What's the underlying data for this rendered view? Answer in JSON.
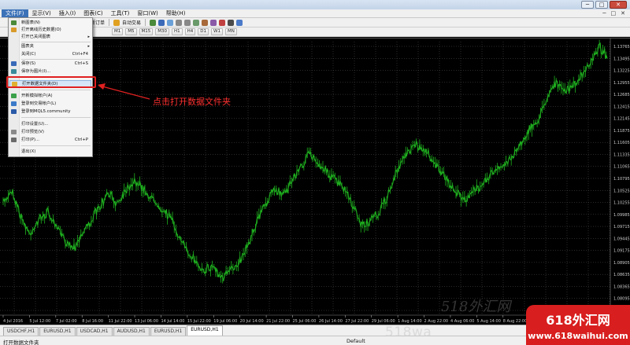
{
  "window": {
    "min_glyph": "─",
    "max_glyph": "□",
    "close_glyph": "✕"
  },
  "menubar": {
    "items": [
      "文件(F)",
      "显示(V)",
      "插入(I)",
      "图表(C)",
      "工具(T)",
      "窗口(W)",
      "帮助(H)"
    ],
    "right_items": [
      "─",
      "□",
      "✕"
    ]
  },
  "toolbar1": {
    "new_order": "新订单",
    "autotrade": "自动交易"
  },
  "toolbar2": {
    "timeframes": [
      "M1",
      "M5",
      "M15",
      "M30",
      "H1",
      "H4",
      "D1",
      "W1",
      "MN"
    ]
  },
  "file_menu": {
    "items": [
      {
        "label": "新图表(N)",
        "shortcut": "",
        "icon": "new-chart-icon",
        "color": "#4a8a3a"
      },
      {
        "label": "打开离线历史数据(O)",
        "shortcut": "",
        "icon": "offline-icon",
        "color": "#d89a2a"
      },
      {
        "label": "打开已关闭图表",
        "shortcut": "",
        "icon": "",
        "color": "",
        "submenu": true
      },
      {
        "label": "图表夹",
        "shortcut": "",
        "icon": "",
        "color": "",
        "submenu": true
      },
      {
        "label": "关闭(C)",
        "shortcut": "Ctrl+F4",
        "icon": "",
        "color": ""
      },
      {
        "label": "保存(S)",
        "shortcut": "Ctrl+S",
        "icon": "save-icon",
        "color": "#3a6ab8"
      },
      {
        "label": "保存为图片(I)...",
        "shortcut": "",
        "icon": "save-picture-icon",
        "color": "#3a8a9a"
      },
      {
        "label": "打开数据文件夹(D)",
        "shortcut": "",
        "icon": "folder-icon",
        "color": "#e0b030",
        "highlighted": true
      },
      {
        "label": "开新模拟帐户(A)",
        "shortcut": "",
        "icon": "demo-account-icon",
        "color": "#3aa04a"
      },
      {
        "label": "登录到交易帐户(L)",
        "shortcut": "",
        "icon": "login-icon",
        "color": "#3a7ac8"
      },
      {
        "label": "登录到MQL5.community",
        "shortcut": "",
        "icon": "mql5-icon",
        "color": "#2a5aa8"
      },
      {
        "label": "打印设置(U)...",
        "shortcut": "",
        "icon": "",
        "color": ""
      },
      {
        "label": "打印预览(V)",
        "shortcut": "",
        "icon": "print-preview-icon",
        "color": "#8a8a8a"
      },
      {
        "label": "打印(P)...",
        "shortcut": "Ctrl+P",
        "icon": "print-icon",
        "color": "#6a6a6a"
      },
      {
        "label": "退出(X)",
        "shortcut": "",
        "icon": "",
        "color": ""
      }
    ]
  },
  "annotation": {
    "text": "点击打开数据文件夹",
    "color": "#ff3030"
  },
  "chart_data": {
    "type": "line",
    "title": "",
    "xlabel": "",
    "ylabel": "",
    "series": [
      {
        "values": [
          1.103,
          1.106,
          1.1,
          1.096,
          1.099,
          1.101,
          1.098,
          1.095,
          1.093,
          1.096,
          1.099,
          1.102,
          1.105,
          1.103,
          1.106,
          1.108,
          1.106,
          1.104,
          1.102,
          1.1,
          1.096,
          1.092,
          1.09,
          1.088,
          1.089,
          1.086,
          1.088,
          1.09,
          1.094,
          1.099,
          1.103,
          1.106,
          1.105,
          1.108,
          1.111,
          1.114,
          1.112,
          1.11,
          1.108,
          1.106,
          1.102,
          1.098,
          1.099,
          1.101,
          1.105,
          1.11,
          1.114,
          1.116,
          1.115,
          1.113,
          1.11,
          1.107,
          1.105,
          1.104,
          1.106,
          1.108,
          1.11,
          1.111,
          1.113,
          1.116,
          1.119,
          1.121,
          1.126,
          1.13,
          1.128,
          1.129,
          1.131,
          1.134,
          1.138,
          1.136
        ]
      }
    ],
    "y_ticks": [
      "1.13765",
      "1.13495",
      "1.13225",
      "1.12955",
      "1.12685",
      "1.12415",
      "1.12145",
      "1.11875",
      "1.11605",
      "1.11335",
      "1.11065",
      "1.10795",
      "1.10525",
      "1.10255",
      "1.09985",
      "1.09715",
      "1.09445",
      "1.09175",
      "1.08905",
      "1.08635",
      "1.08365",
      "1.08095",
      "1.07825"
    ],
    "ylim": [
      1.078,
      1.139
    ],
    "x_ticks": [
      "4 Jul 2016",
      "5 Jul 12:00",
      "7 Jul 02:00",
      "8 Jul 16:00",
      "11 Jul 22:00",
      "13 Jul 06:00",
      "14 Jul 14:00",
      "15 Jul 22:00",
      "19 Jul 06:00",
      "20 Jul 14:00",
      "21 Jul 22:00",
      "25 Jul 06:00",
      "26 Jul 14:00",
      "27 Jul 22:00",
      "29 Jul 06:00",
      "1 Aug 14:00",
      "2 Aug 22:00",
      "4 Aug 06:00",
      "5 Aug 14:00",
      "8 Aug 22:00",
      "10 Aug 06:00",
      "11 Aug 14:00",
      "12 Aug 22:00"
    ],
    "grid": true,
    "line_color": "#1fb01f",
    "background": "#000000"
  },
  "tabs": [
    "USDCHF,H1",
    "EURUSD,H1",
    "USDCAD,H1",
    "AUDUSD,H1",
    "EURUSD,H1",
    "EURUSD,H1"
  ],
  "active_tab_index": 5,
  "status": {
    "left": "打开数据文件夹",
    "mid": "Default"
  },
  "watermarks": {
    "italic": "518外汇网",
    "bottom": "518wa",
    "logo_line1": "618外汇网",
    "logo_line2": "www.618waihui.com"
  }
}
